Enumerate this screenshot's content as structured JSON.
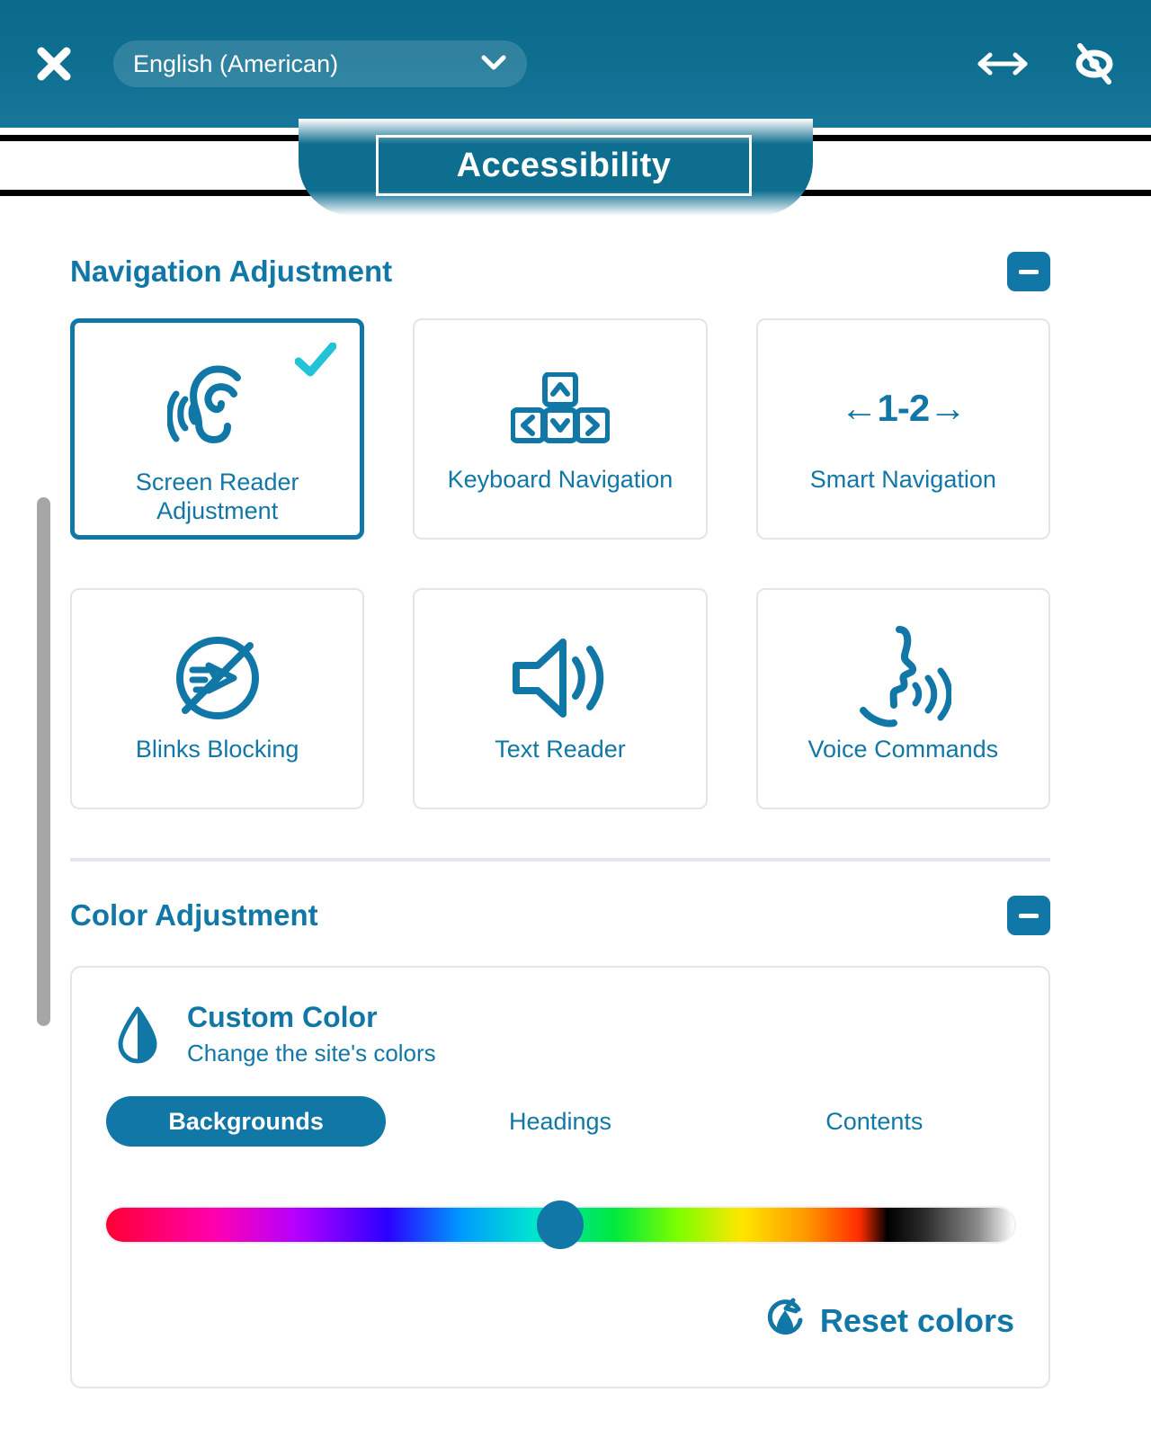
{
  "header": {
    "close_icon": "close-x-icon",
    "language": {
      "selected": "English (American)",
      "chevron_icon": "chevron-down-icon"
    },
    "resize_icon": "horizontal-resize-arrows-icon",
    "hide_icon": "eye-slash-icon"
  },
  "tabs": {
    "active_label": "Accessibility"
  },
  "sections": [
    {
      "title": "Navigation Adjustment",
      "collapse_icon": "minus-icon",
      "cards": [
        {
          "label": "Screen Reader Adjustment",
          "icon": "ear-sound-icon",
          "active": true,
          "check_icon": "check-icon"
        },
        {
          "label": "Keyboard Navigation",
          "icon": "arrow-keys-icon",
          "active": false
        },
        {
          "label": "Smart Navigation",
          "icon": "arrow-1-2-arrow-text-icon",
          "active": false,
          "icon_text": "←1-2→"
        },
        {
          "label": "Blinks Blocking",
          "icon": "no-blink-blocked-icon",
          "active": false
        },
        {
          "label": "Text Reader",
          "icon": "speaker-volume-icon",
          "active": false
        },
        {
          "label": "Voice Commands",
          "icon": "face-speaking-icon",
          "active": false
        }
      ]
    },
    {
      "title": "Color Adjustment",
      "collapse_icon": "minus-icon"
    }
  ],
  "custom_color": {
    "drop_icon": "contrast-droplet-icon",
    "title": "Custom Color",
    "subtitle": "Change the site's colors",
    "pills": [
      {
        "label": "Backgrounds",
        "active": true
      },
      {
        "label": "Headings",
        "active": false
      },
      {
        "label": "Contents",
        "active": false
      }
    ],
    "slider": {
      "value_percent": 50,
      "thumb_color": "#1177a6"
    },
    "reset": {
      "label": "Reset colors",
      "icon": "reset-droplet-icon"
    }
  },
  "scrollbar": {
    "thumb": "vertical-scrollbar-thumb"
  },
  "colors": {
    "brand": "#1177a6",
    "header_bg": "#0e6e90",
    "check": "#22c3d6",
    "card_border": "#e4e3ee",
    "scrollbar": "#a6a6a6"
  }
}
